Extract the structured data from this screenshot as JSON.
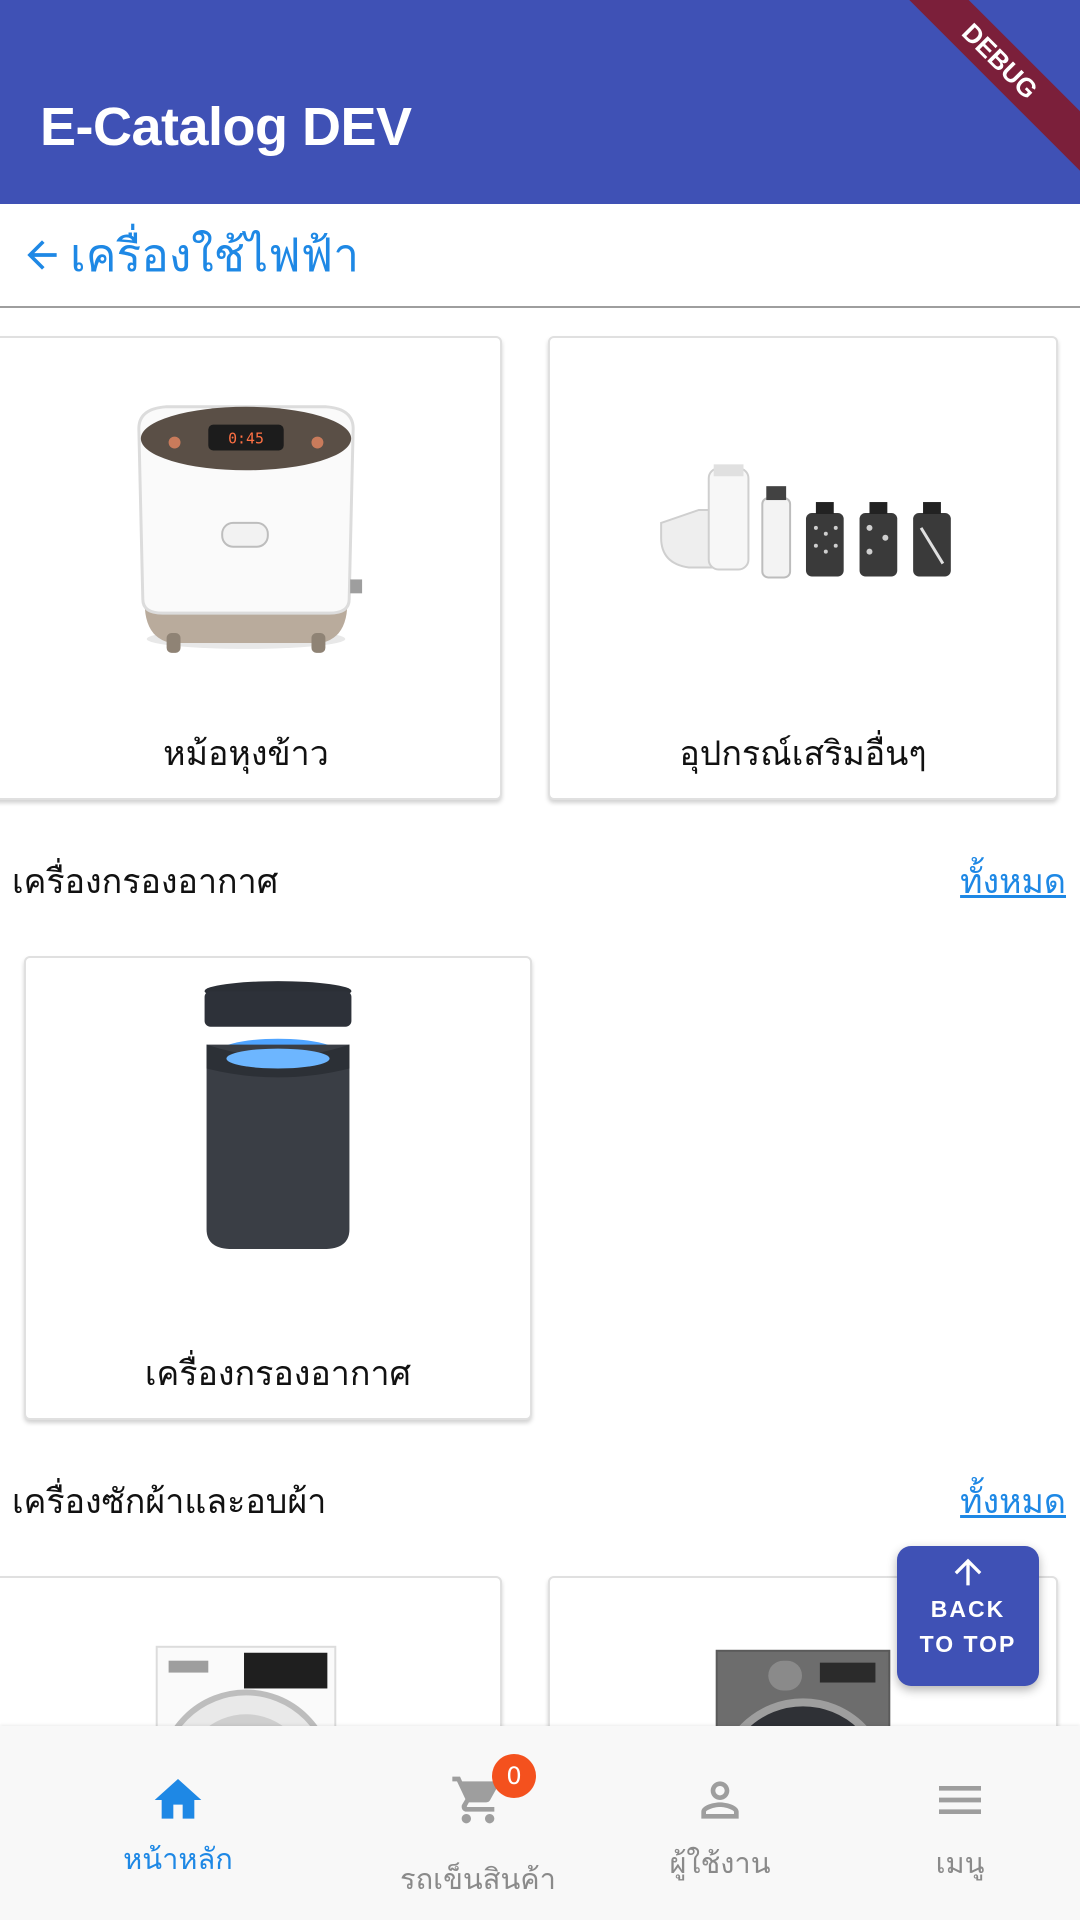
{
  "app": {
    "title": "E-Catalog DEV",
    "debug_banner": "DEBUG"
  },
  "breadcrumb": {
    "label": "เครื่องใช้ไฟฟ้า"
  },
  "top_products": [
    {
      "label": "หม้อหุงข้าว",
      "icon": "rice-cooker"
    },
    {
      "label": "อุปกรณ์เสริมอื่นๆ",
      "icon": "mixer-attachments"
    }
  ],
  "sections": [
    {
      "title": "เครื่องกรองอากาศ",
      "see_all": "ทั้งหมด",
      "products": [
        {
          "label": "เครื่องกรองอากาศ",
          "icon": "air-purifier"
        }
      ]
    },
    {
      "title": "เครื่องซักผ้าและอบผ้า",
      "see_all": "ทั้งหมด",
      "products": [
        {
          "icon": "dryer"
        },
        {
          "icon": "washing-machine"
        }
      ]
    }
  ],
  "back_to_top": {
    "line1": "BACK",
    "line2": "TO TOP"
  },
  "bottom_nav": {
    "items": [
      {
        "label": "หน้าหลัก",
        "icon": "home-icon",
        "active": true
      },
      {
        "label": "รถเข็นสินค้า",
        "icon": "cart-icon",
        "badge": "0"
      },
      {
        "label": "ผู้ใช้งาน",
        "icon": "user-icon"
      },
      {
        "label": "เมนู",
        "icon": "menu-icon"
      }
    ]
  },
  "colors": {
    "primary": "#3f51b5",
    "accent": "#1e88e5",
    "badge": "#f4511e",
    "debug": "#7b1f3a"
  }
}
